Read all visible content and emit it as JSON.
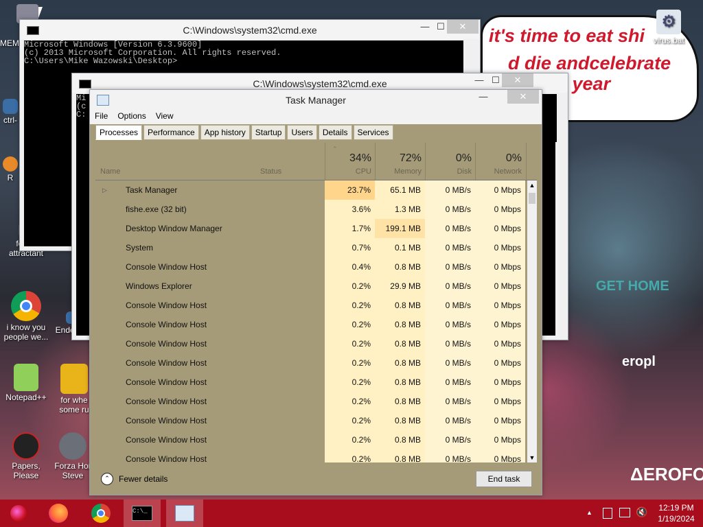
{
  "desktop": {
    "ad_lines": [
      "it's time to eat shi",
      "d die andcelebrate",
      "ew year"
    ],
    "city_text": [
      "GET HOME",
      "ΔEROFOS",
      "eropl"
    ],
    "icons": [
      {
        "label": "MEM",
        "icon": "document-icon"
      },
      {
        "label": "ctrl-",
        "icon": "shortcut-icon"
      },
      {
        "label": "R",
        "icon": "app-icon"
      },
      {
        "label": "forkie attractant",
        "icon": "shortcut-icon"
      },
      {
        "label": "i know you people we...",
        "icon": "chrome-icon"
      },
      {
        "label": "Enderma",
        "icon": "shortcut-icon"
      },
      {
        "label": "Notepad++",
        "icon": "notepadpp-icon"
      },
      {
        "label": "for whe some ru",
        "icon": "app-icon"
      },
      {
        "label": "Papers, Please",
        "icon": "papers-please-icon"
      },
      {
        "label": "Forza Hor Steve",
        "icon": "flash-icon"
      },
      {
        "label": "virus.bat",
        "icon": "gear-icon"
      }
    ]
  },
  "cmd1": {
    "title": "C:\\Windows\\system32\\cmd.exe",
    "lines": [
      "Microsoft Windows [Version 6.3.9600]",
      "(c) 2013 Microsoft Corporation. All rights reserved.",
      "",
      "C:\\Users\\Mike Wazowski\\Desktop>"
    ]
  },
  "cmd2": {
    "title": "C:\\Windows\\system32\\cmd.exe",
    "lines": [
      "Mi",
      "(c",
      "",
      "C:"
    ]
  },
  "task_manager": {
    "title": "Task Manager",
    "menu": [
      "File",
      "Options",
      "View"
    ],
    "tabs": [
      "Processes",
      "Performance",
      "App history",
      "Startup",
      "Users",
      "Details",
      "Services"
    ],
    "columns": {
      "name": "Name",
      "status": "Status",
      "cpu": {
        "pct": "34%",
        "label": "CPU"
      },
      "memory": {
        "pct": "72%",
        "label": "Memory"
      },
      "disk": {
        "pct": "0%",
        "label": "Disk"
      },
      "network": {
        "pct": "0%",
        "label": "Network"
      }
    },
    "rows": [
      {
        "name": "Task Manager",
        "cpu": "23.7%",
        "mem": "65.1 MB",
        "disk": "0 MB/s",
        "net": "0 Mbps",
        "expand": "▷"
      },
      {
        "name": "fishe.exe (32 bit)",
        "cpu": "3.6%",
        "mem": "1.3 MB",
        "disk": "0 MB/s",
        "net": "0 Mbps",
        "expand": ""
      },
      {
        "name": "Desktop Window Manager",
        "cpu": "1.7%",
        "mem": "199.1 MB",
        "disk": "0 MB/s",
        "net": "0 Mbps",
        "expand": ""
      },
      {
        "name": "System",
        "cpu": "0.7%",
        "mem": "0.1 MB",
        "disk": "0 MB/s",
        "net": "0 Mbps",
        "expand": ""
      },
      {
        "name": "Console Window Host",
        "cpu": "0.4%",
        "mem": "0.8 MB",
        "disk": "0 MB/s",
        "net": "0 Mbps",
        "expand": ""
      },
      {
        "name": "Windows Explorer",
        "cpu": "0.2%",
        "mem": "29.9 MB",
        "disk": "0 MB/s",
        "net": "0 Mbps",
        "expand": ""
      },
      {
        "name": "Console Window Host",
        "cpu": "0.2%",
        "mem": "0.8 MB",
        "disk": "0 MB/s",
        "net": "0 Mbps",
        "expand": ""
      },
      {
        "name": "Console Window Host",
        "cpu": "0.2%",
        "mem": "0.8 MB",
        "disk": "0 MB/s",
        "net": "0 Mbps",
        "expand": ""
      },
      {
        "name": "Console Window Host",
        "cpu": "0.2%",
        "mem": "0.8 MB",
        "disk": "0 MB/s",
        "net": "0 Mbps",
        "expand": ""
      },
      {
        "name": "Console Window Host",
        "cpu": "0.2%",
        "mem": "0.8 MB",
        "disk": "0 MB/s",
        "net": "0 Mbps",
        "expand": ""
      },
      {
        "name": "Console Window Host",
        "cpu": "0.2%",
        "mem": "0.8 MB",
        "disk": "0 MB/s",
        "net": "0 Mbps",
        "expand": ""
      },
      {
        "name": "Console Window Host",
        "cpu": "0.2%",
        "mem": "0.8 MB",
        "disk": "0 MB/s",
        "net": "0 Mbps",
        "expand": ""
      },
      {
        "name": "Console Window Host",
        "cpu": "0.2%",
        "mem": "0.8 MB",
        "disk": "0 MB/s",
        "net": "0 Mbps",
        "expand": ""
      },
      {
        "name": "Console Window Host",
        "cpu": "0.2%",
        "mem": "0.8 MB",
        "disk": "0 MB/s",
        "net": "0 Mbps",
        "expand": ""
      },
      {
        "name": "Console Window Host",
        "cpu": "0.2%",
        "mem": "0.8 MB",
        "disk": "0 MB/s",
        "net": "0 Mbps",
        "expand": ""
      }
    ],
    "fewer_details": "Fewer details",
    "end_task": "End task"
  },
  "taskbar": {
    "apps": [
      "start-icon",
      "firefox-icon",
      "chrome-icon",
      "cmd-icon",
      "task-manager-icon"
    ],
    "time": "12:19 PM",
    "date": "1/19/2024"
  },
  "colors": {
    "taskbar": "#a80d1e",
    "tm_background": "#a59b78",
    "heat": "#fff1c4"
  }
}
